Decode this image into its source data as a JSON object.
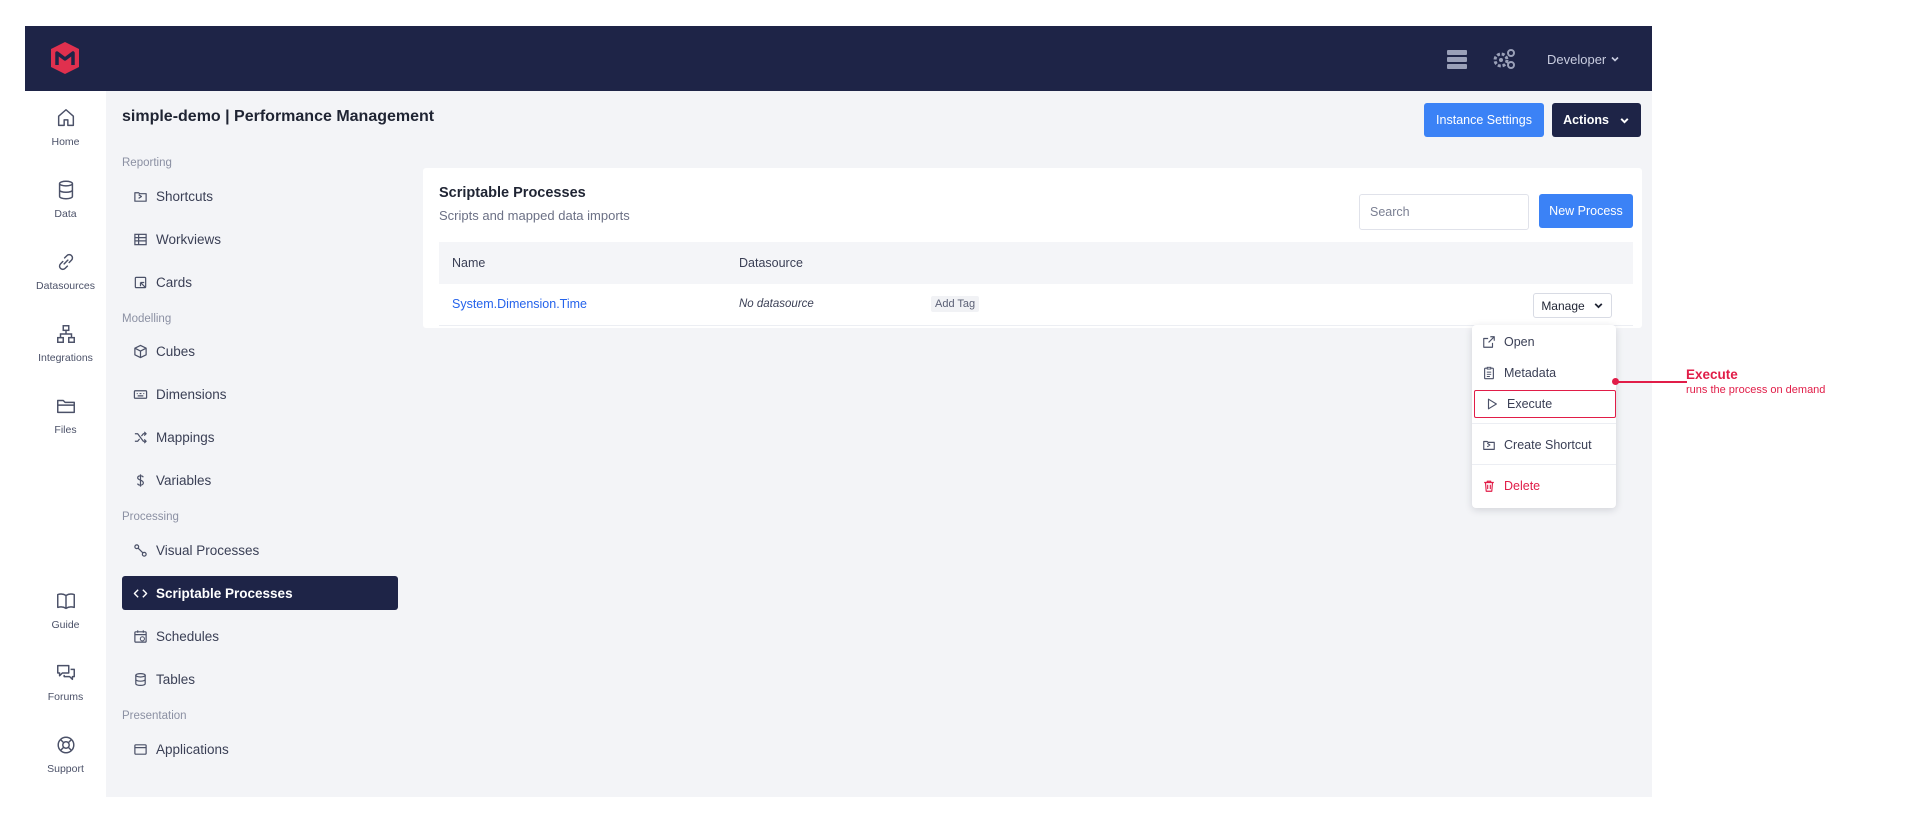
{
  "topbar": {
    "user_label": "Developer"
  },
  "rail": {
    "items": [
      {
        "label": "Home",
        "icon": "home-icon"
      },
      {
        "label": "Data",
        "icon": "database-icon"
      },
      {
        "label": "Datasources",
        "icon": "link-icon"
      },
      {
        "label": "Integrations",
        "icon": "network-icon"
      },
      {
        "label": "Files",
        "icon": "folder-icon"
      }
    ],
    "bottom": [
      {
        "label": "Guide",
        "icon": "book-icon"
      },
      {
        "label": "Forums",
        "icon": "chat-icon"
      },
      {
        "label": "Support",
        "icon": "lifebuoy-icon"
      }
    ]
  },
  "header": {
    "title": "simple-demo | Performance Management",
    "instance_settings": "Instance Settings",
    "actions": "Actions"
  },
  "sidebar": {
    "sections": [
      {
        "title": "Reporting",
        "items": [
          "Shortcuts",
          "Workviews",
          "Cards"
        ]
      },
      {
        "title": "Modelling",
        "items": [
          "Cubes",
          "Dimensions",
          "Mappings",
          "Variables"
        ]
      },
      {
        "title": "Processing",
        "items": [
          "Visual Processes",
          "Scriptable Processes",
          "Schedules",
          "Tables"
        ]
      },
      {
        "title": "Presentation",
        "items": [
          "Applications"
        ]
      }
    ],
    "active": "Scriptable Processes"
  },
  "card": {
    "title": "Scriptable Processes",
    "subtitle": "Scripts and mapped data imports",
    "search_placeholder": "Search",
    "new_button": "New Process",
    "columns": [
      "Name",
      "Datasource"
    ],
    "rows": [
      {
        "name": "System.Dimension.Time",
        "datasource": "No datasource",
        "tag": "Add Tag",
        "manage": "Manage"
      }
    ]
  },
  "dropdown": {
    "items": [
      "Open",
      "Metadata",
      "Execute",
      "Create Shortcut",
      "Delete"
    ]
  },
  "annotation": {
    "title": "Execute",
    "subtitle": "runs the process on demand",
    "color": "#e11d48"
  },
  "colors": {
    "navy": "#1e2447",
    "primary": "#3b82f6",
    "danger": "#e11d48",
    "brand": "#e0304e"
  }
}
